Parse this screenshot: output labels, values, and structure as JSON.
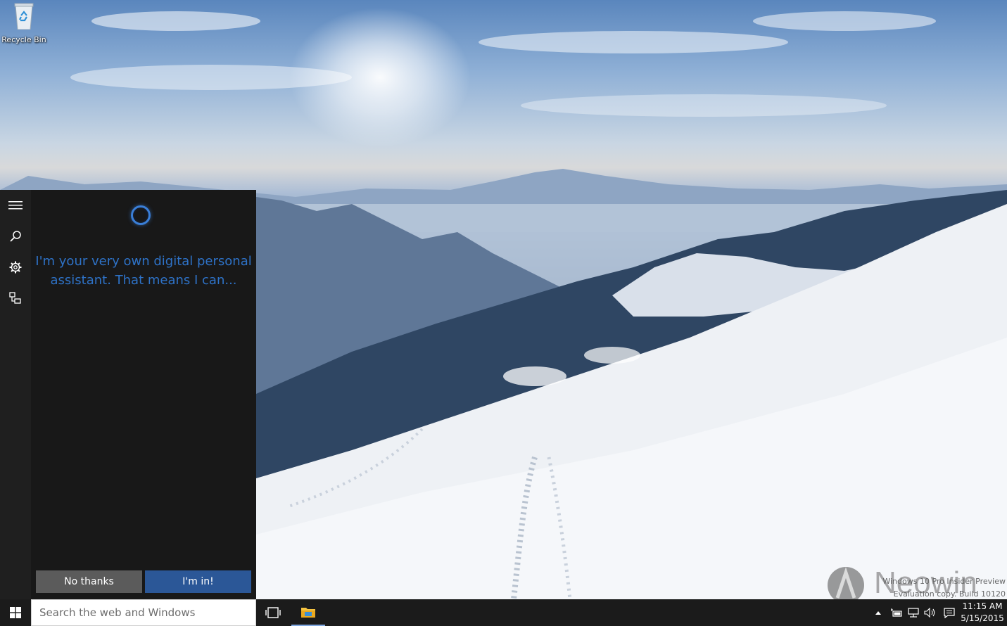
{
  "desktop": {
    "icons": [
      {
        "label": "Recycle Bin",
        "icon": "recycle-bin-icon"
      }
    ]
  },
  "cortana": {
    "rail": [
      {
        "icon": "hamburger-menu-icon"
      },
      {
        "icon": "search-icon"
      },
      {
        "icon": "settings-gear-icon"
      },
      {
        "icon": "feedback-icon"
      }
    ],
    "intro_text": "I'm your very own digital personal assistant. That means I can...",
    "no_thanks_label": "No thanks",
    "im_in_label": "I'm in!",
    "accent_color": "#2e72c7"
  },
  "taskbar": {
    "start_icon": "windows-logo-icon",
    "search_placeholder": "Search the web and Windows",
    "pinned": [
      {
        "icon": "task-view-icon"
      },
      {
        "icon": "file-explorer-icon"
      }
    ],
    "tray": {
      "icons": [
        "show-hidden-icons-chevron",
        "power-battery-icon",
        "network-icon",
        "volume-icon",
        "action-center-icon"
      ],
      "time": "11:15 AM",
      "date": "5/15/2015"
    }
  },
  "watermark": {
    "line1": "Windows 10 Pro Insider Preview",
    "line2": "Evaluation copy. Build 10120",
    "brand": "Neowin"
  }
}
